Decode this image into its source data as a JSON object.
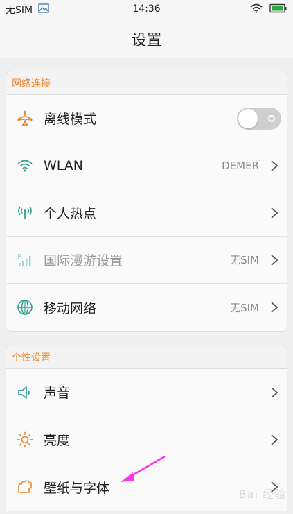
{
  "status_bar": {
    "carrier": "无SIM",
    "time": "14:36"
  },
  "title": "设置",
  "groups": [
    {
      "header": "网络连接",
      "items": [
        {
          "label": "离线模式",
          "icon": "airplane-icon",
          "control": "toggle",
          "toggle_on": false
        },
        {
          "label": "WLAN",
          "icon": "wifi-icon",
          "value": "DEMER"
        },
        {
          "label": "个人热点",
          "icon": "hotspot-icon"
        },
        {
          "label": "国际漫游设置",
          "icon": "roaming-signal-icon",
          "value": "无SIM",
          "disabled": true
        },
        {
          "label": "移动网络",
          "icon": "globe-icon",
          "value": "无SIM"
        }
      ]
    },
    {
      "header": "个性设置",
      "items": [
        {
          "label": "声音",
          "icon": "speaker-icon"
        },
        {
          "label": "亮度",
          "icon": "brightness-icon"
        },
        {
          "label": "壁纸与字体",
          "icon": "wallpaper-icon"
        }
      ]
    }
  ],
  "colors": {
    "accent_orange": "#e8892f",
    "teal": "#2e9e8f",
    "annotation_arrow": "#ff33e6"
  }
}
